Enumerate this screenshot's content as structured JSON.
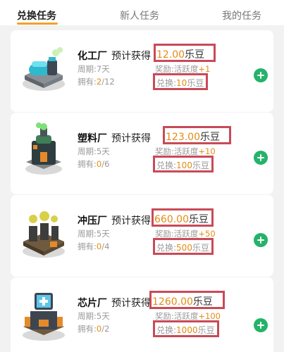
{
  "tabs": {
    "exchange": "兑换任务",
    "newbie": "新人任务",
    "mine": "我的任务"
  },
  "labels": {
    "predict": "预计获得",
    "unit": "乐豆",
    "period_prefix": "周期:",
    "owned_prefix": "拥有:",
    "reward_prefix": "奖励:活跃度",
    "exchange_prefix": "兑换:"
  },
  "factories": [
    {
      "name": "化工厂",
      "price": "12.00",
      "period": "7天",
      "owned": "2",
      "total": "/12",
      "reward": "+1",
      "exchange": "10",
      "icon": "chemical-factory-icon"
    },
    {
      "name": "塑料厂",
      "price": "123.00",
      "period": "5天",
      "owned": "0",
      "total": "/6",
      "reward": "+10",
      "exchange": "100",
      "icon": "plastic-factory-icon"
    },
    {
      "name": "冲压厂",
      "price": "660.00",
      "period": "5天",
      "owned": "0",
      "total": "/4",
      "reward": "+50",
      "exchange": "500",
      "icon": "stamping-factory-icon"
    },
    {
      "name": "芯片厂",
      "price": "1260.00",
      "period": "5天",
      "owned": "0",
      "total": "/2",
      "reward": "+100",
      "exchange": "1000",
      "icon": "chip-factory-icon"
    }
  ],
  "colors": {
    "accent": "#e48b15",
    "highlight_border": "#c94a58",
    "add_button": "#25b36a",
    "tab_underline": "#f0a12a"
  }
}
